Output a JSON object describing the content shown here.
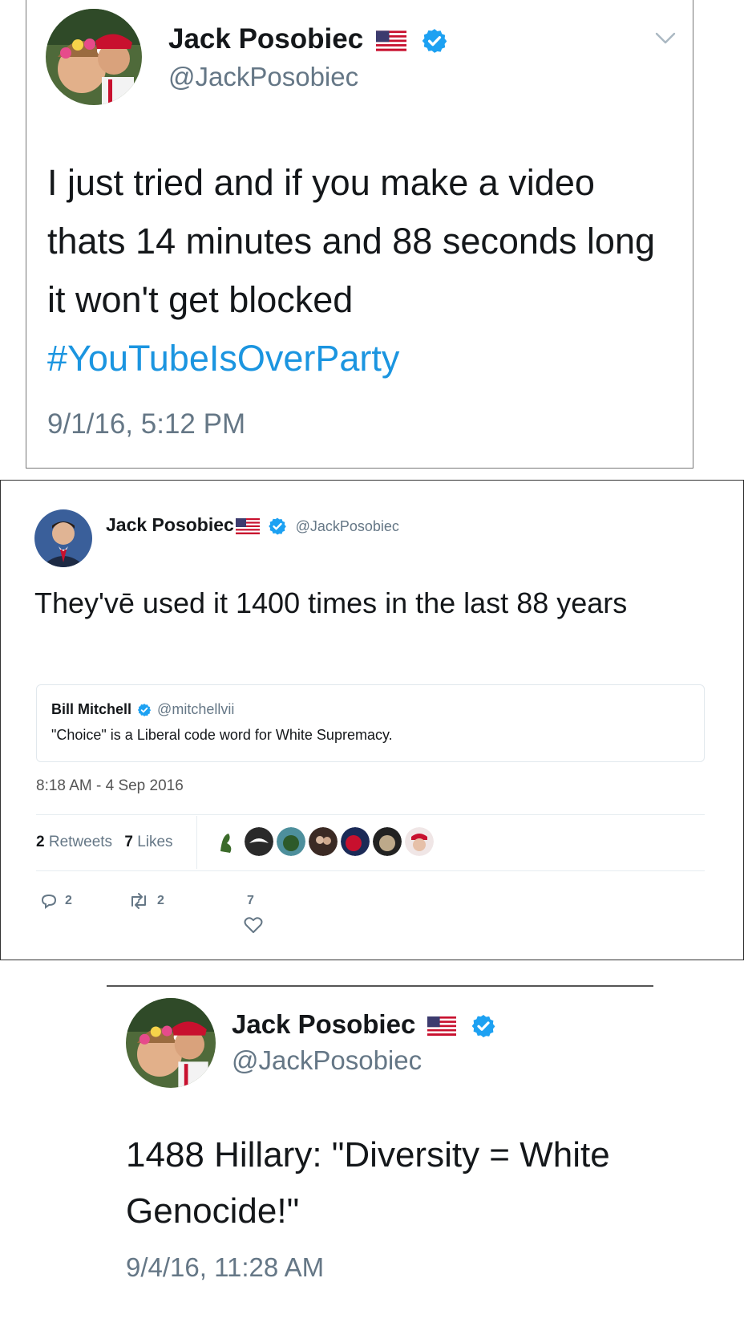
{
  "tweet1": {
    "display_name": "Jack Posobiec",
    "handle": "@JackPosobiec",
    "text": "I just tried and if you make a video thats 14 minutes and 88 seconds long it won't get blocked",
    "hashtag": "#YouTubeIsOverParty",
    "timestamp": "9/1/16, 5:12 PM",
    "icons": [
      "us-flag-icon",
      "verified-badge-icon",
      "chevron-down-icon"
    ]
  },
  "tweet2": {
    "display_name": "Jack Posobiec",
    "handle": "@JackPosobiec",
    "text": "They'vē used it 1400 times in the last 88 years",
    "quoted": {
      "display_name": "Bill Mitchell",
      "handle": "@mitchellvii",
      "text": "\"Choice\" is a Liberal code word for White Supremacy."
    },
    "timestamp": "8:18 AM - 4 Sep 2016",
    "retweets_count": "2",
    "retweets_label": "Retweets",
    "likes_count": "7",
    "likes_label": "Likes",
    "reply_count": "2",
    "retweet_action_count": "2",
    "like_action_count": "7",
    "icons": [
      "us-flag-icon",
      "verified-badge-icon",
      "reply-icon",
      "retweet-icon",
      "heart-icon"
    ]
  },
  "tweet3": {
    "display_name": "Jack Posobiec",
    "handle": "@JackPosobiec",
    "text": "1488 Hillary: \"Diversity = White Genocide!\"",
    "timestamp": "9/4/16, 11:28 AM",
    "icons": [
      "us-flag-icon",
      "verified-badge-icon"
    ]
  },
  "colors": {
    "verified_blue": "#1da1f2",
    "hashtag_blue": "#1b95e0",
    "muted_gray": "#657786",
    "text_dark": "#14171a"
  }
}
